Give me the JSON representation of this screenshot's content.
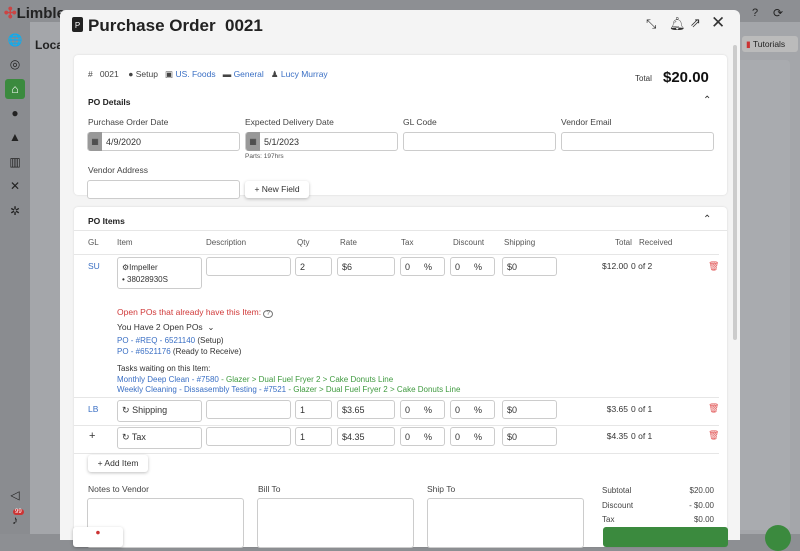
{
  "app": {
    "logo_text": "Limble",
    "location_title": "Loca",
    "tutorials_label": "Tutorials",
    "notification_count": "99"
  },
  "modal": {
    "title": "Purchase Order",
    "number": "0021"
  },
  "meta": {
    "hash": "#",
    "po_number": "0021",
    "status": "Setup",
    "vendor": "US. Foods",
    "budget": "General",
    "user": "Lucy Murray",
    "total_label": "Total",
    "total_value": "$20.00"
  },
  "details": {
    "section_title": "PO Details",
    "po_date_label": "Purchase Order Date",
    "po_date": "4/9/2020",
    "delivery_label": "Expected Delivery Date",
    "delivery_date": "5/1/2023",
    "parts_note": "Parts: 197hrs",
    "gl_label": "GL Code",
    "gl_value": "",
    "email_label": "Vendor Email",
    "email_value": "",
    "address_label": "Vendor Address",
    "address_value": "",
    "new_field_label": "+ New Field"
  },
  "items": {
    "section_title": "PO Items",
    "columns": [
      "GL",
      "Item",
      "Description",
      "Qty",
      "Rate",
      "Tax",
      "Discount",
      "Shipping",
      "Total",
      "Received"
    ],
    "rows": [
      {
        "gl": "SU",
        "item": "Impeller",
        "item_code": "• 38028930S",
        "description": "",
        "qty": "2",
        "rate": "$6",
        "tax": "0",
        "tax_unit": "%",
        "discount": "0",
        "discount_unit": "%",
        "shipping": "$0",
        "total": "$12.00",
        "received": "0 of 2"
      },
      {
        "gl": "LB",
        "item": "Shipping",
        "description": "",
        "qty": "1",
        "rate": "$3.65",
        "tax": "0",
        "tax_unit": "%",
        "discount": "0",
        "discount_unit": "%",
        "shipping": "$0",
        "total": "$3.65",
        "received": "0 of 1"
      },
      {
        "gl": "+",
        "item": "Tax",
        "description": "",
        "qty": "1",
        "rate": "$4.35",
        "tax": "0",
        "tax_unit": "%",
        "discount": "0",
        "discount_unit": "%",
        "shipping": "$0",
        "total": "$4.35",
        "received": "0 of 1"
      }
    ],
    "open_pos_warning": "Open POs that already have this Item:",
    "open_pos_toggle": "You Have 2 Open POs",
    "open_pos": [
      {
        "link": "PO - #REQ - 6521140",
        "status": "(Setup)"
      },
      {
        "link": "PO - #6521176",
        "status": "(Ready to Receive)"
      }
    ],
    "tasks_label": "Tasks waiting on this Item:",
    "tasks": [
      {
        "link": "Monthly Deep Clean - #7580",
        "path": "- Glazer > Dual Fuel Fryer 2 > Cake Donuts Line"
      },
      {
        "link": "Weekly Cleaning - Dissasembly Testing - #7521",
        "path": "- Glazer > Dual Fuel Fryer 2 > Cake Donuts Line"
      }
    ],
    "add_item_label": "+ Add Item"
  },
  "footer": {
    "notes_label": "Notes to Vendor",
    "bill_label": "Bill To",
    "ship_label": "Ship To",
    "summary": [
      {
        "label": "Subtotal",
        "value": "$20.00"
      },
      {
        "label": "Discount",
        "value": "- $0.00"
      },
      {
        "label": "Tax",
        "value": "$0.00"
      }
    ]
  },
  "colors": {
    "accent": "#3b8a3e",
    "link": "#3a6fc4",
    "danger": "#e05353"
  }
}
